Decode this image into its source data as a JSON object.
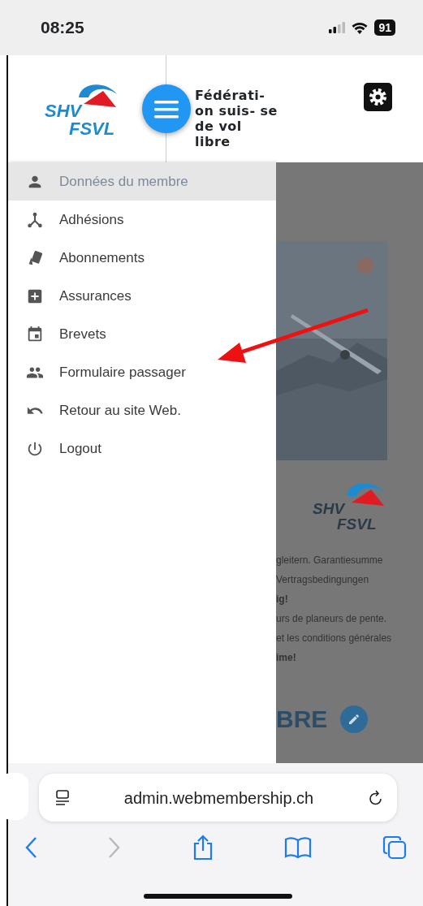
{
  "status_bar": {
    "time": "08:25",
    "battery": "91"
  },
  "header": {
    "logo": {
      "line_1": "SHV",
      "line_2": "FSVL"
    },
    "title": "Fédérati- on suis- se de vol libre"
  },
  "menu": [
    {
      "label": "Données du membre",
      "selected": true
    },
    {
      "label": "Adhésions",
      "selected": false
    },
    {
      "label": "Abonnements",
      "selected": false
    },
    {
      "label": "Assurances",
      "selected": false
    },
    {
      "label": "Brevets",
      "selected": false
    },
    {
      "label": "Formulaire passager",
      "selected": false
    },
    {
      "label": "Retour au site Web.",
      "selected": false
    },
    {
      "label": "Logout",
      "selected": false
    }
  ],
  "background_page": {
    "logo": {
      "line_1": "SHV",
      "line_2": "FSVL"
    },
    "texts": [
      {
        "text": "gleitern. Garantiesumme",
        "bold": false
      },
      {
        "text": "Vertragsbedingungen",
        "bold": false
      },
      {
        "text": "ig!",
        "bold": true
      },
      {
        "text": "urs de planeurs de pente.",
        "bold": false
      },
      {
        "text": "et les conditions générales",
        "bold": false
      },
      {
        "text": "ime!",
        "bold": true
      }
    ],
    "heading": "BRE"
  },
  "browser": {
    "url": "admin.webmembership.ch",
    "back_disabled": false,
    "forward_disabled": true
  }
}
